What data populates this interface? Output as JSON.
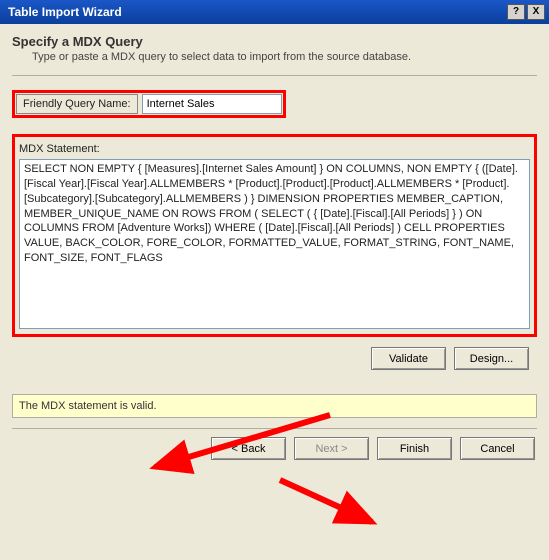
{
  "window": {
    "title": "Table Import Wizard",
    "help_glyph": "?",
    "close_glyph": "X"
  },
  "header": {
    "title": "Specify a MDX Query",
    "description": "Type or paste a MDX query to select data to import from the source database."
  },
  "fields": {
    "friendly_name_label": "Friendly Query Name:",
    "friendly_name_value": "Internet Sales",
    "mdx_label": "MDX Statement:",
    "mdx_value": "SELECT NON EMPTY { [Measures].[Internet Sales Amount] } ON COLUMNS, NON EMPTY { ([Date].[Fiscal Year].[Fiscal Year].ALLMEMBERS * [Product].[Product].[Product].ALLMEMBERS * [Product].[Subcategory].[Subcategory].ALLMEMBERS ) } DIMENSION PROPERTIES MEMBER_CAPTION, MEMBER_UNIQUE_NAME ON ROWS FROM ( SELECT ( { [Date].[Fiscal].[All Periods] } ) ON COLUMNS FROM [Adventure Works]) WHERE ( [Date].[Fiscal].[All Periods] ) CELL PROPERTIES VALUE, BACK_COLOR, FORE_COLOR, FORMATTED_VALUE, FORMAT_STRING, FONT_NAME, FONT_SIZE, FONT_FLAGS"
  },
  "buttons": {
    "validate": "Validate",
    "design": "Design...",
    "back": "< Back",
    "next": "Next >",
    "finish": "Finish",
    "cancel": "Cancel"
  },
  "status": {
    "message": "The MDX statement is valid."
  },
  "colors": {
    "titlebar": "#0a3f9c",
    "panel": "#ece9d8",
    "status_bg": "#ffffcc",
    "highlight": "#ff0000"
  }
}
